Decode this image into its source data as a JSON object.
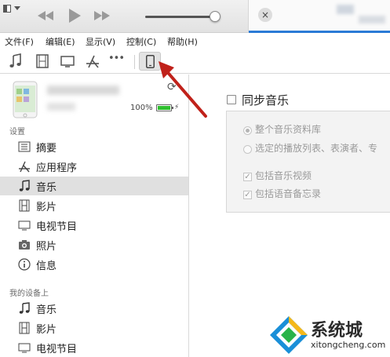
{
  "menubar": {
    "items": [
      "文件(F)",
      "编辑(E)",
      "显示(V)",
      "控制(C)",
      "帮助(H)"
    ]
  },
  "player": {
    "close_glyph": "×"
  },
  "toolbar": {
    "icons": [
      "music-icon",
      "movie-icon",
      "tv-icon",
      "app-store-icon",
      "more-icon",
      "iphone-icon"
    ],
    "more_glyph": "•••"
  },
  "device": {
    "battery_percent": "100%",
    "battery_level": 1.0,
    "sync_glyph": "⟳",
    "charging_glyph": "⚡"
  },
  "sidebar": {
    "settings_header": "设置",
    "settings_items": [
      {
        "label": "摘要",
        "icon": "summary-icon",
        "selected": false
      },
      {
        "label": "应用程序",
        "icon": "apps-icon",
        "selected": false
      },
      {
        "label": "音乐",
        "icon": "music-icon",
        "selected": true
      },
      {
        "label": "影片",
        "icon": "film-icon",
        "selected": false
      },
      {
        "label": "电视节目",
        "icon": "tv-icon",
        "selected": false
      },
      {
        "label": "照片",
        "icon": "camera-icon",
        "selected": false
      },
      {
        "label": "信息",
        "icon": "info-icon",
        "selected": false
      }
    ],
    "mydevice_header": "我的设备上",
    "mydevice_items": [
      {
        "label": "音乐",
        "icon": "music-icon"
      },
      {
        "label": "影片",
        "icon": "film-icon"
      },
      {
        "label": "电视节目",
        "icon": "tv-icon"
      }
    ]
  },
  "main": {
    "sync_music_label": "同步音乐",
    "sync_music_checked": false,
    "options": {
      "entire_library": "整个音乐资料库",
      "selected_playlists": "选定的播放列表、表演者、专",
      "include_videos": "包括音乐视频",
      "include_voice_memos": "包括语音备忘录"
    }
  },
  "watermark": {
    "brand": "系统城",
    "url": "xitongcheng.com"
  },
  "colors": {
    "accent_blue": "#2b7bd6",
    "arrow_red": "#c0211a",
    "battery_green": "#2fbf2f",
    "logo_blue": "#1a8fd8"
  }
}
